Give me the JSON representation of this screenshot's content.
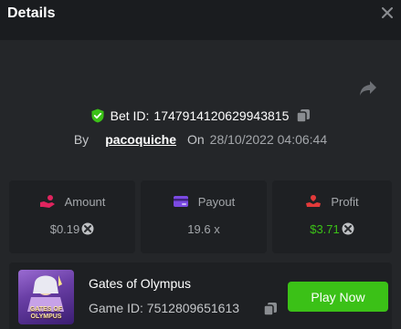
{
  "header": {
    "title": "Details"
  },
  "bet": {
    "id_label": "Bet ID:",
    "id_value": "1747914120629943815",
    "by_label": "By",
    "username": "pacoquiche",
    "on_label": "On",
    "date": "28/10/2022 04:06:44"
  },
  "stats": {
    "amount": {
      "label": "Amount",
      "value": "$0.19"
    },
    "payout": {
      "label": "Payout",
      "value": "19.6 x"
    },
    "profit": {
      "label": "Profit",
      "value": "$3.71"
    }
  },
  "game": {
    "title": "Gates of Olympus",
    "id_text": "Game ID: 7512809651613",
    "thumb_text_1": "GATES OF",
    "thumb_text_2": "OLYMPUS",
    "play_label": "Play Now"
  },
  "colors": {
    "accent_green": "#3bc117",
    "profit_green": "#3bc117",
    "amount_icon": "#e0245e",
    "payout_icon": "#7b4ae2",
    "profit_icon": "#e23a3a"
  }
}
